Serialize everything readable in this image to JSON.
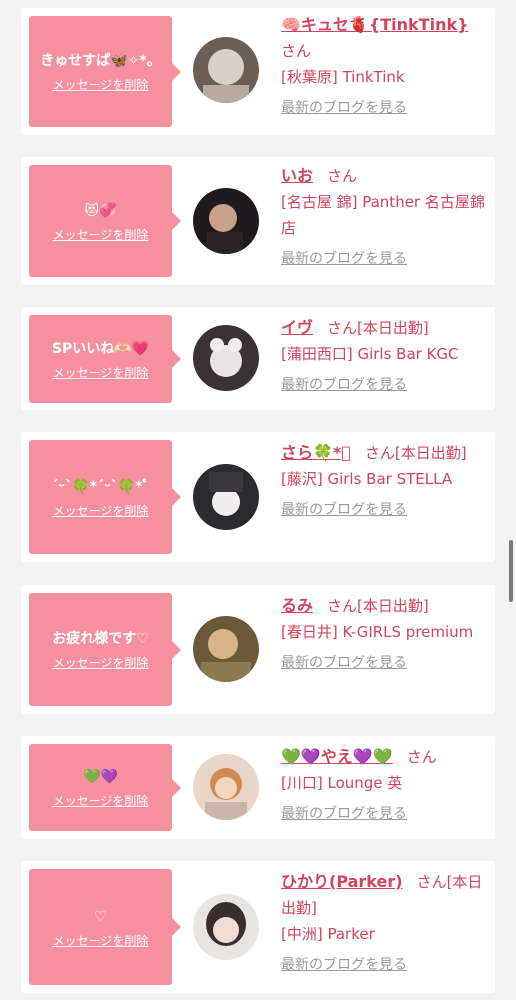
{
  "accent_color": "#f7909e",
  "text_color": "#d0445e",
  "link_gray": "#9a9a9a",
  "delete_label": "メッセージを削除",
  "blog_label": "最新のブログを見る",
  "items": [
    {
      "message": "きゅせすぱ🦋✧*。",
      "name": "🧠キュセ🫀{TinkTink}",
      "suffix": "さん",
      "shop": "[秋葉原] TinkTink",
      "avatar_colors": [
        "#d9d0c8",
        "#6a5e55"
      ]
    },
    {
      "message": "😻💞",
      "name": "いお",
      "suffix": "さん",
      "shop": "[名古屋 錦] Panther 名古屋錦店",
      "avatar_colors": [
        "#1e1a1d",
        "#c9a18a"
      ]
    },
    {
      "message": "SPいいね🫶🏻💗",
      "name": "イヴ",
      "suffix": "さん[本日出勤]",
      "shop": "[蒲田西口] Girls Bar KGC",
      "avatar_colors": [
        "#3b3236",
        "#e8e3e4"
      ]
    },
    {
      "message": "ˊᵕˋ🍀*ˊᵕˋ🍀*ﾟ",
      "name": "さら🍀*ﾟ",
      "suffix": "さん[本日出勤]",
      "shop": "[藤沢] Girls Bar STELLA",
      "avatar_colors": [
        "#2b2a2e",
        "#f1eef0"
      ]
    },
    {
      "message": "お疲れ様です♡",
      "name": "るみ",
      "suffix": "さん[本日出勤]",
      "shop": "[春日井] K-GIRLS premium",
      "avatar_colors": [
        "#6a5a3a",
        "#d9b58a"
      ]
    },
    {
      "message": "💚💜",
      "name": "💚💜やえ💜💚",
      "suffix": "さん",
      "shop": "[川口] Lounge 英",
      "avatar_colors": [
        "#e8d7c8",
        "#d28a55"
      ]
    },
    {
      "message": "♡",
      "name": "ひかり(Parker)",
      "suffix": "さん[本日出勤]",
      "shop": "[中洲] Parker",
      "avatar_colors": [
        "#e8e4e2",
        "#3a2e2c"
      ]
    }
  ]
}
